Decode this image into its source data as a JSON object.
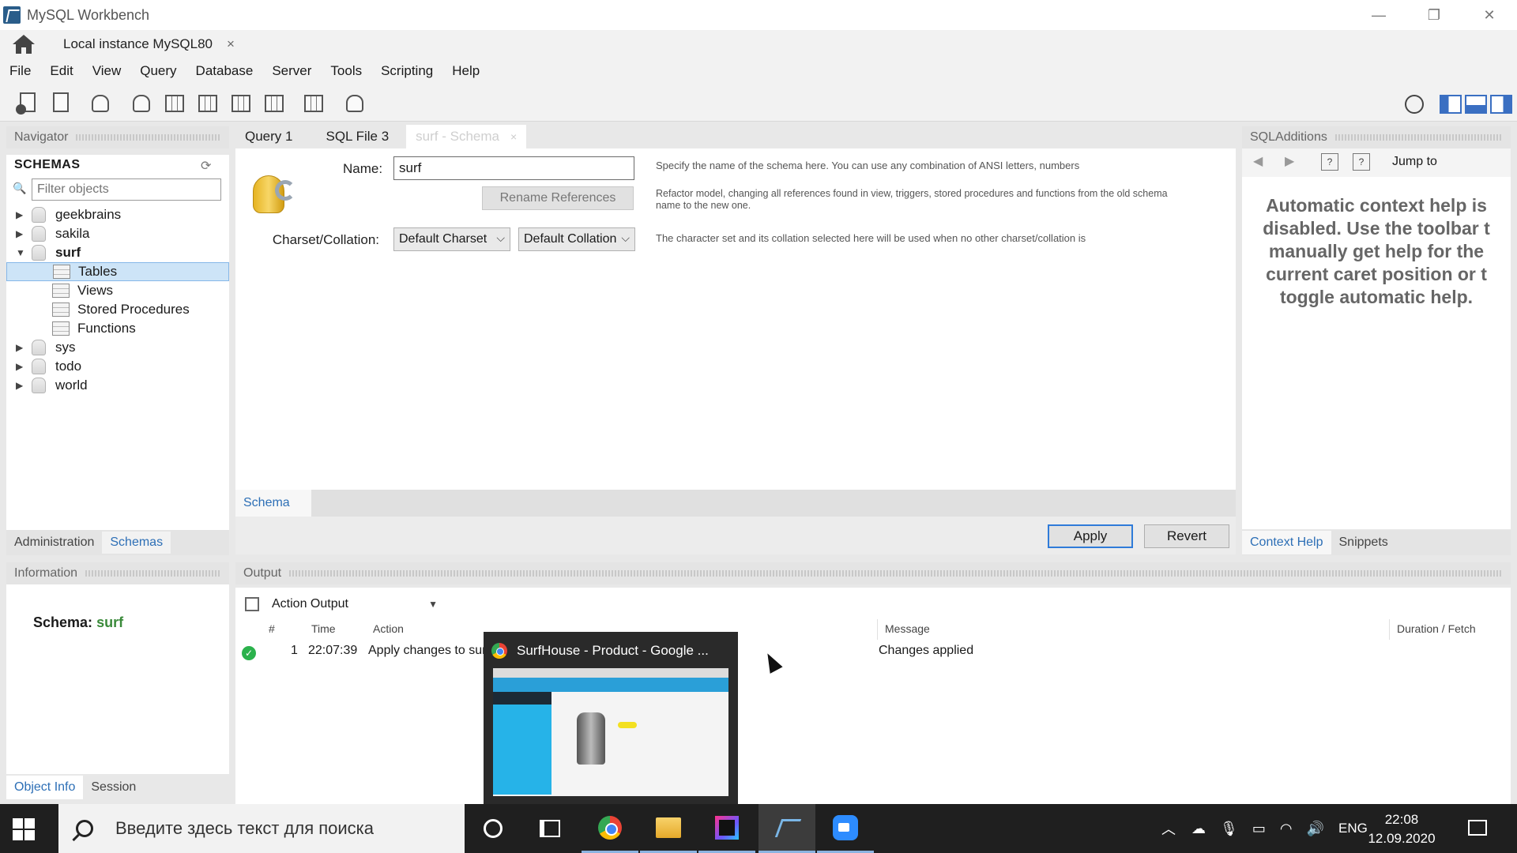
{
  "window": {
    "title": "MySQL Workbench",
    "minimize": "—",
    "restore": "❐",
    "close": "✕"
  },
  "connection_tab": {
    "label": "Local instance MySQL80",
    "close": "×"
  },
  "menu": [
    "File",
    "Edit",
    "View",
    "Query",
    "Database",
    "Server",
    "Tools",
    "Scripting",
    "Help"
  ],
  "toolbar": {
    "icons": [
      "new-sql-tab-icon",
      "open-sql-script-icon",
      "schema-inspector-icon",
      "create-schema-icon",
      "create-table-icon",
      "create-view-icon",
      "create-procedure-icon",
      "create-function-icon",
      "search-table-data-icon",
      "reconnect-icon"
    ],
    "layout_buttons": [
      "toggle-sidebar",
      "toggle-output",
      "toggle-sqladditions"
    ]
  },
  "navigator": {
    "header": "Navigator",
    "schemas_title": "SCHEMAS",
    "filter_placeholder": "Filter objects",
    "tree": [
      {
        "label": "geekbrains",
        "expanded": false
      },
      {
        "label": "sakila",
        "expanded": false
      },
      {
        "label": "surf",
        "expanded": true,
        "children": [
          "Tables",
          "Views",
          "Stored Procedures",
          "Functions"
        ]
      },
      {
        "label": "sys",
        "expanded": false
      },
      {
        "label": "todo",
        "expanded": false
      },
      {
        "label": "world",
        "expanded": false
      }
    ],
    "selected": "Tables",
    "tabs": [
      "Administration",
      "Schemas"
    ],
    "active_tab": "Schemas"
  },
  "information": {
    "header": "Information",
    "schema_label": "Schema:",
    "schema_value": "surf",
    "tabs": [
      "Object Info",
      "Session"
    ],
    "active_tab": "Object Info"
  },
  "editor_tabs": [
    {
      "label": "Query 1",
      "active": false
    },
    {
      "label": "SQL File 3",
      "active": false
    },
    {
      "label": "surf - Schema",
      "active": true,
      "close": "×"
    }
  ],
  "schema_editor": {
    "name_label": "Name:",
    "name_value": "surf",
    "rename_button": "Rename References",
    "charset_label": "Charset/Collation:",
    "charset_value": "Default Charset",
    "collation_value": "Default Collation",
    "help_name": "Specify the name of the schema here. You can use any combination of ANSI letters, numbers",
    "help_rename": "Refactor model, changing all references found in view, triggers, stored procedures and functions from the old schema name to the new one.",
    "help_charset": "The character set and its collation selected here will be used when no other charset/collation is",
    "bottom_tab": "Schema",
    "apply": "Apply",
    "revert": "Revert"
  },
  "sql_additions": {
    "header": "SQLAdditions",
    "jump_to": "Jump to",
    "context_help": "Automatic context help is disabled. Use the toolbar t manually get help for the current caret position or t toggle automatic help.",
    "tabs": [
      "Context Help",
      "Snippets"
    ],
    "active_tab": "Context Help"
  },
  "output": {
    "header": "Output",
    "selector": "Action Output",
    "columns": [
      "#",
      "Time",
      "Action",
      "Message",
      "Duration / Fetch"
    ],
    "rows": [
      {
        "num": "1",
        "time": "22:07:39",
        "action": "Apply changes to surf",
        "message": "Changes applied",
        "duration": ""
      }
    ]
  },
  "taskbar_preview": {
    "title": "SurfHouse - Product - Google ..."
  },
  "taskbar": {
    "search_placeholder": "Введите здесь текст для поиска",
    "apps": [
      "cortana",
      "task-view",
      "chrome",
      "file-explorer",
      "intellij",
      "mysql-workbench",
      "zoom"
    ],
    "language": "ENG",
    "time": "22:08",
    "date": "12.09.2020"
  }
}
